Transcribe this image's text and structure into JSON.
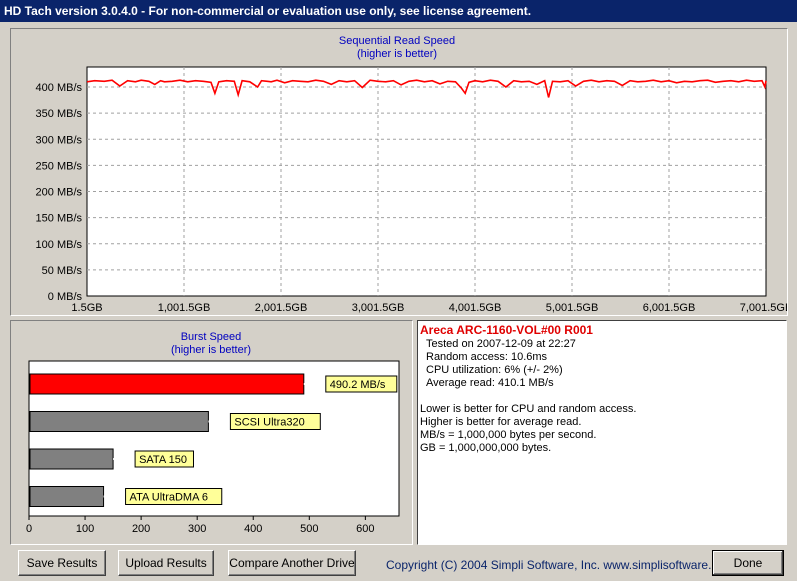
{
  "window": {
    "title": "HD Tach version 3.0.4.0  - For non-commercial or evaluation use only, see license agreement."
  },
  "sequential": {
    "title": "Sequential Read Speed",
    "subtitle": "(higher is better)",
    "y_ticks": [
      "0 MB/s",
      "50 MB/s",
      "100 MB/s",
      "150 MB/s",
      "200 MB/s",
      "250 MB/s",
      "300 MB/s",
      "350 MB/s",
      "400 MB/s"
    ],
    "x_ticks": [
      "1.5GB",
      "1,001.5GB",
      "2,001.5GB",
      "3,001.5GB",
      "4,001.5GB",
      "5,001.5GB",
      "6,001.5GB",
      "7,001.5GE"
    ]
  },
  "burst": {
    "title": "Burst Speed",
    "subtitle": "(higher is better)",
    "x_ticks": [
      "0",
      "100",
      "200",
      "300",
      "400",
      "500",
      "600"
    ]
  },
  "chart_data": [
    {
      "type": "line",
      "title": "Sequential Read Speed",
      "subtitle": "(higher is better)",
      "xlabel": "",
      "ylabel": "",
      "ylim": [
        0,
        400
      ],
      "xlim": [
        1.5,
        7001.5
      ],
      "x_unit": "GB",
      "y_unit": "MB/s",
      "grid": true,
      "series": [
        {
          "color": "#ff0000",
          "x": [
            1.5,
            80,
            180,
            260,
            340,
            420,
            500,
            560,
            640,
            700,
            760,
            800,
            880,
            960,
            1040,
            1120,
            1200,
            1280,
            1320,
            1360,
            1440,
            1520,
            1560,
            1600,
            1680,
            1760,
            1800,
            1860,
            1900,
            1960,
            2040,
            2120,
            2200,
            2280,
            2360,
            2440,
            2520,
            2600,
            2680,
            2760,
            2840,
            2920,
            3000,
            3080,
            3160,
            3240,
            3320,
            3400,
            3480,
            3560,
            3640,
            3720,
            3800,
            3860,
            3900,
            3940,
            4000,
            4080,
            4160,
            4240,
            4320,
            4400,
            4480,
            4560,
            4640,
            4720,
            4760,
            4800,
            4880,
            4960,
            5040,
            5120,
            5200,
            5280,
            5360,
            5440,
            5520,
            5600,
            5680,
            5760,
            5840,
            5920,
            6000,
            6080,
            6160,
            6240,
            6320,
            6400,
            6480,
            6560,
            6640,
            6720,
            6800,
            6880,
            6960,
            6990,
            7001.5
          ],
          "y": [
            410,
            412,
            411,
            413,
            402,
            412,
            410,
            413,
            411,
            405,
            412,
            410,
            411,
            413,
            410,
            412,
            411,
            409,
            388,
            410,
            412,
            411,
            385,
            412,
            410,
            400,
            412,
            411,
            410,
            413,
            408,
            412,
            411,
            410,
            413,
            411,
            405,
            412,
            410,
            412,
            399,
            413,
            411,
            410,
            412,
            404,
            411,
            413,
            410,
            412,
            406,
            411,
            410,
            398,
            388,
            409,
            412,
            410,
            413,
            411,
            400,
            412,
            410,
            411,
            405,
            412,
            380,
            411,
            410,
            412,
            402,
            411,
            413,
            410,
            412,
            411,
            403,
            412,
            410,
            411,
            413,
            410,
            412,
            408,
            411,
            410,
            412,
            413,
            409,
            411,
            412,
            410,
            413,
            411,
            412,
            400,
            412
          ]
        }
      ]
    },
    {
      "type": "bar",
      "orientation": "horizontal",
      "title": "Burst Speed",
      "subtitle": "(higher is better)",
      "xlabel": "",
      "ylabel": "",
      "xlim": [
        0,
        660
      ],
      "categories": [
        "490.2 MB/s",
        "SCSI Ultra320",
        "SATA 150",
        "ATA UltraDMA 6"
      ],
      "values": [
        490.2,
        320,
        150,
        133
      ],
      "colors": [
        "#ff0000",
        "#808080",
        "#808080",
        "#808080"
      ]
    }
  ],
  "info": {
    "drive": "Areca ARC-1160-VOL#00 R001",
    "tested": "Tested on 2007-12-09 at 22:27",
    "random": "Random access: 10.6ms",
    "cpu": "CPU utilization: 6% (+/- 2%)",
    "avg": "Average read: 410.1 MB/s",
    "note1": "Lower is better for CPU and random access.",
    "note2": "Higher is better for average read.",
    "note3": "MB/s = 1,000,000 bytes per second.",
    "note4": "GB = 1,000,000,000 bytes."
  },
  "buttons": {
    "save": "Save Results",
    "upload": "Upload Results",
    "compare": "Compare Another Drive",
    "done": "Done"
  },
  "footer": {
    "copyright": "Copyright (C) 2004 Simpli Software, Inc. www.simplisoftware.com"
  }
}
